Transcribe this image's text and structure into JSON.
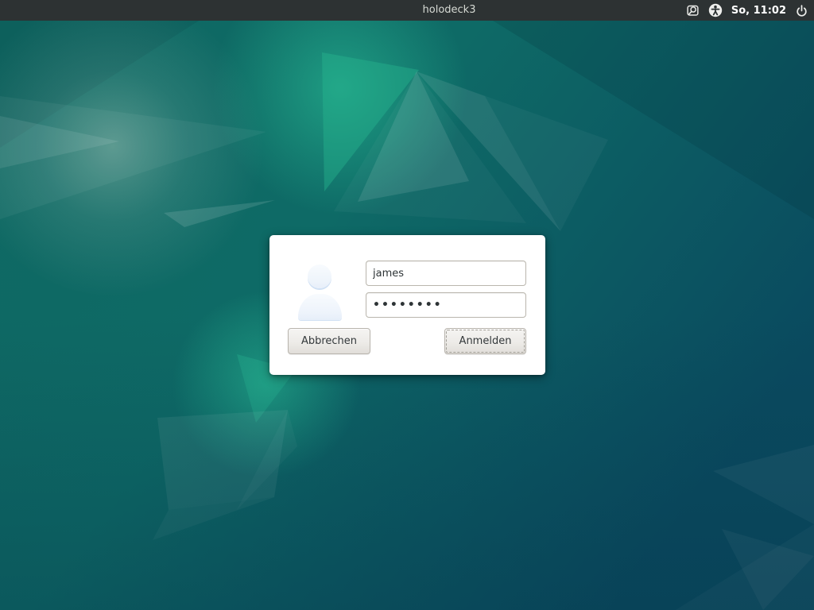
{
  "top_bar": {
    "hostname": "holodeck3",
    "clock": "So, 11:02",
    "icons": {
      "screen_magnifier": "screen-magnifier-icon",
      "accessibility": "accessibility-icon",
      "power": "power-icon"
    }
  },
  "login_dialog": {
    "avatar": "user-avatar-icon",
    "username_input": {
      "value": "james"
    },
    "password_input": {
      "value_masked": "••••••••",
      "dot_count": 8
    },
    "cancel_button_label": "Abbrechen",
    "login_button_label": "Anmelden",
    "focused_button": "Anmelden"
  },
  "colors": {
    "top_bar_bg": "#2d3233",
    "top_bar_text": "#d6dad4",
    "clock_text": "#ffffff",
    "wallpaper_teal": "#0e6a66",
    "wallpaper_blue": "#0a4a5f",
    "wallpaper_emerald": "#27b891",
    "dialog_bg": "#ffffff",
    "field_border": "#bab6ad",
    "button_border": "#b8b4ad",
    "text_dark": "#2e3436",
    "avatar_fill": "#eef4fb"
  }
}
